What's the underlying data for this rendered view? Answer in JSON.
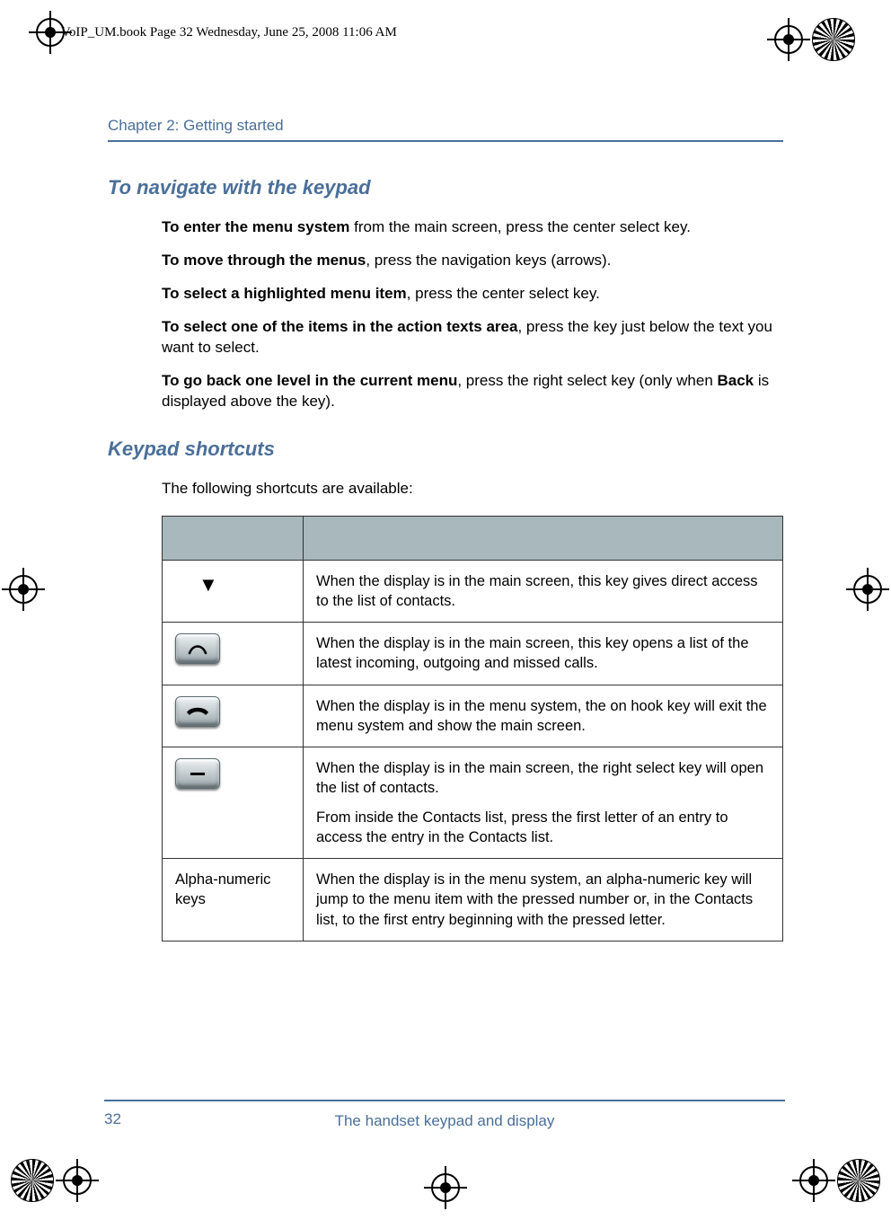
{
  "running_head": "VoIP_UM.book  Page 32  Wednesday, June 25, 2008  11:06 AM",
  "chapter": "Chapter 2:  Getting started",
  "section1": {
    "title": "To navigate with the keypad",
    "p1_bold": "To enter the menu system",
    "p1_rest": " from the main screen, press the center select key.",
    "p2_bold": "To move through the menus",
    "p2_rest": ", press the navigation keys (arrows).",
    "p3_bold": "To select a highlighted menu item",
    "p3_rest": ", press the center select key.",
    "p4_bold": "To select one of the items in the action texts area",
    "p4_rest": ", press the key just below the text you want to select.",
    "p5_bold_a": "To go back one level in the current menu",
    "p5_rest_a": ", press the right select key (only when ",
    "p5_bold_b": "Back",
    "p5_rest_b": " is displayed above the key)."
  },
  "section2": {
    "title": "Keypad shortcuts",
    "intro": "The following shortcuts are available:",
    "rows": {
      "r1_key": "down-arrow-icon",
      "r1_desc": "When the display is in the main screen, this key gives direct access to the list of contacts.",
      "r2_key": "off-hook-key-icon",
      "r2_desc": "When the display is in the main screen, this key opens a list of the latest incoming, outgoing and missed calls.",
      "r3_key": "on-hook-key-icon",
      "r3_desc": "When the display is in the menu system, the on hook key will exit the menu system and show the main screen.",
      "r4_key": "right-select-key-icon",
      "r4_desc_a": "When the display is in the main screen, the right select key will open the list of contacts.",
      "r4_desc_b": "From inside the Contacts list, press the first letter of an entry to access the entry in the Contacts list.",
      "r5_key": "Alpha-numeric keys",
      "r5_desc": "When the display is in the menu system, an alpha-numeric key will jump to the menu item with the pressed number or, in the Contacts list, to the first entry beginning with the pressed letter."
    }
  },
  "footer": {
    "page_number": "32",
    "title": "The handset keypad and display"
  }
}
